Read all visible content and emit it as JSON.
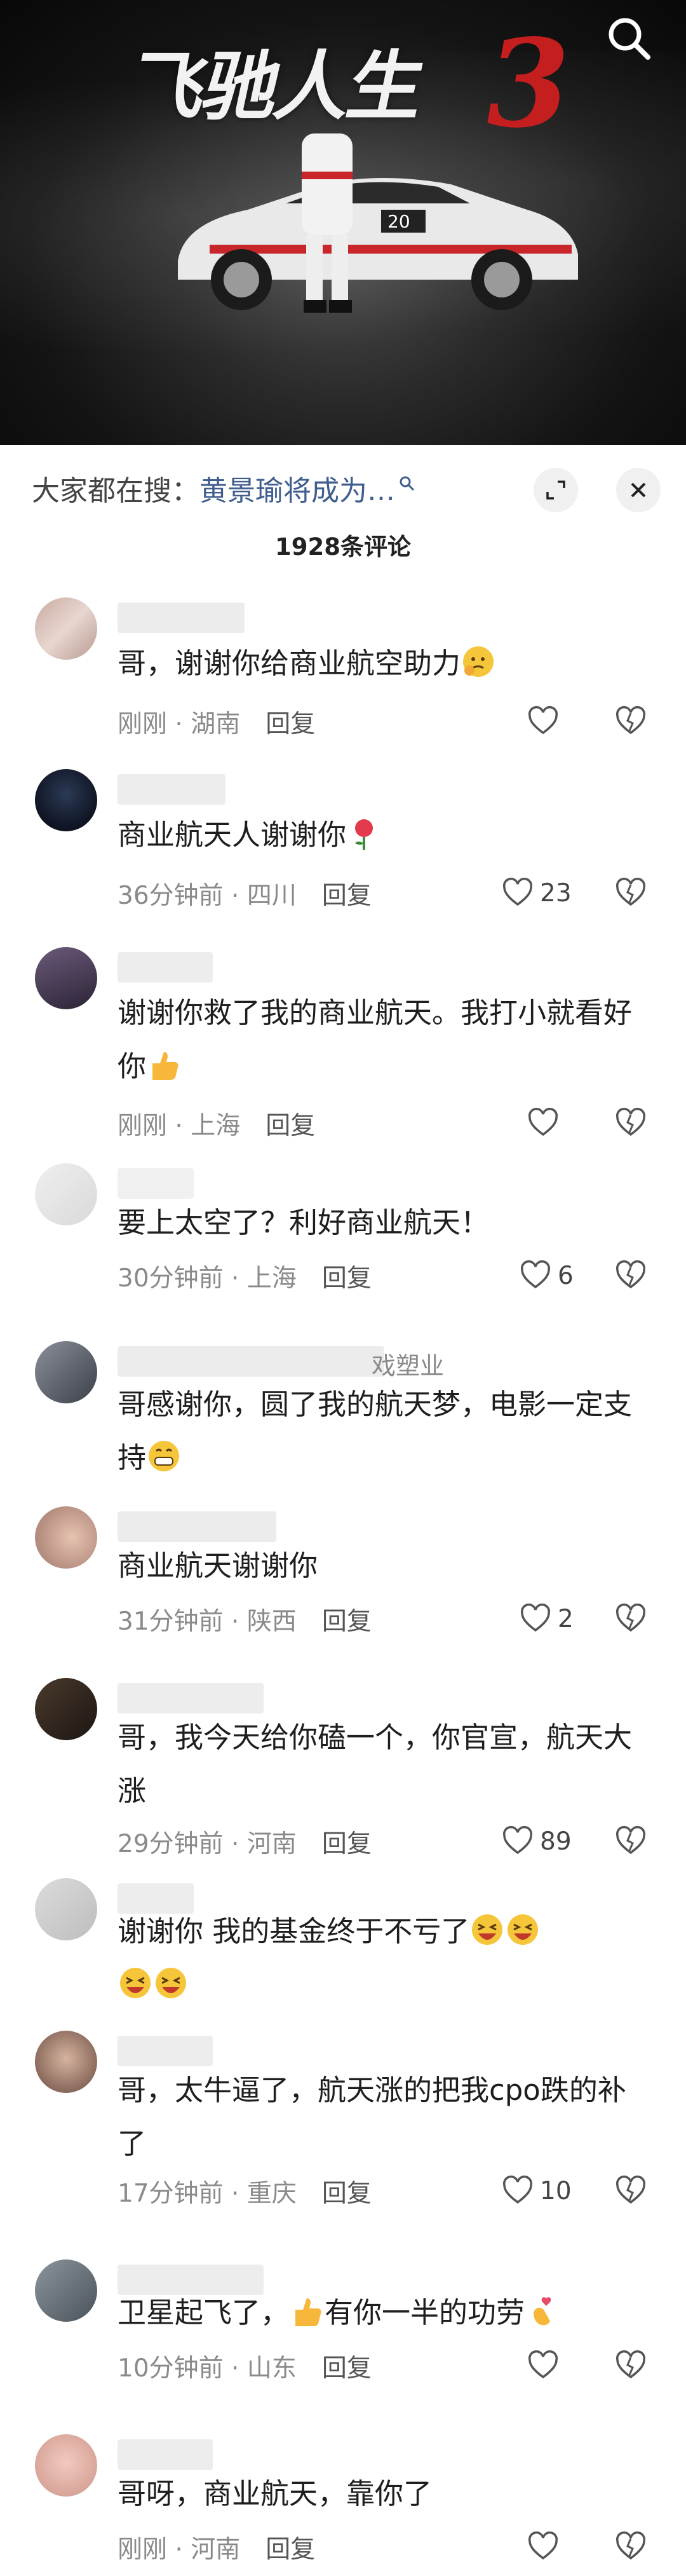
{
  "video": {
    "title_text": "飞驰人生",
    "title_number": "3",
    "car_number": "20"
  },
  "header": {
    "suggest_prefix": "大家都在搜：",
    "suggest_term": "黄景瑜将成为…",
    "comment_count": "1928条评论"
  },
  "comments": [
    {
      "text": "哥，谢谢你给商业航空助力",
      "time": "刚刚",
      "location": "湖南",
      "reply": "回复",
      "likes": ""
    },
    {
      "text": "商业航天人谢谢你",
      "time": "36分钟前",
      "location": "四川",
      "reply": "回复",
      "likes": "23"
    },
    {
      "text": "谢谢你救了我的商业航天。我打小就看好你",
      "time": "刚刚",
      "location": "上海",
      "reply": "回复",
      "likes": ""
    },
    {
      "text": "要上太空了？利好商业航天！",
      "time": "30分钟前",
      "location": "上海",
      "reply": "回复",
      "likes": "6"
    },
    {
      "text": "哥感谢你，圆了我的航天梦，电影一定支持",
      "time": "",
      "location": "",
      "reply": "",
      "likes": ""
    },
    {
      "text": "商业航天谢谢你",
      "time": "31分钟前",
      "location": "陕西",
      "reply": "回复",
      "likes": "2"
    },
    {
      "text": "哥，我今天给你磕一个，你官宣，航天大涨",
      "time": "29分钟前",
      "location": "河南",
      "reply": "回复",
      "likes": "89"
    },
    {
      "text": "谢谢你 我的基金终于不亏了",
      "time": "",
      "location": "",
      "reply": "",
      "likes": ""
    },
    {
      "text": "哥，太牛逼了，航天涨的把我cpo跌的补了",
      "time": "17分钟前",
      "location": "重庆",
      "reply": "回复",
      "likes": "10"
    },
    {
      "text": "卫星起飞了，",
      "text2": "有你一半的功劳",
      "time": "10分钟前",
      "location": "山东",
      "reply": "回复",
      "likes": ""
    },
    {
      "text": "哥呀，商业航天，靠你了",
      "time": "刚刚",
      "location": "河南",
      "reply": "回复",
      "likes": ""
    }
  ],
  "partial_usernames": {
    "c5": "戏塑业"
  },
  "icons": [
    "search-icon",
    "expand-icon",
    "close-icon",
    "like-heart-icon",
    "dislike-heart-icon"
  ]
}
